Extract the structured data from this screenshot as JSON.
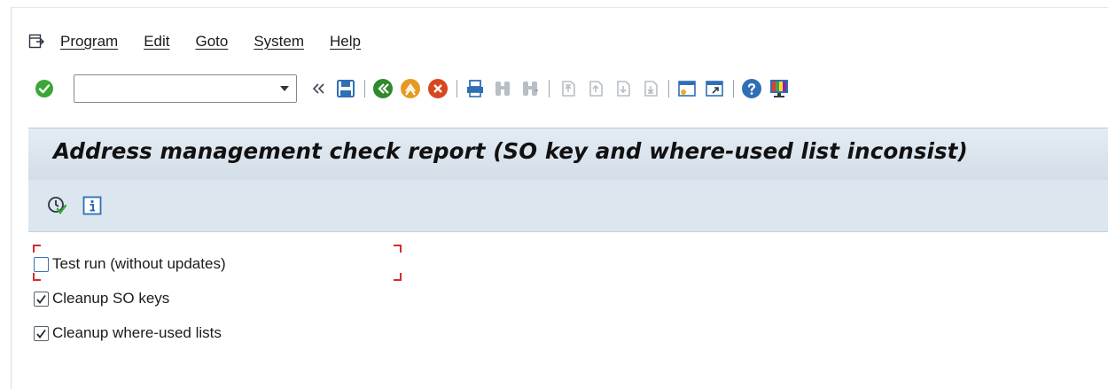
{
  "menu": {
    "items": [
      {
        "label": "Program"
      },
      {
        "label": "Edit"
      },
      {
        "label": "Goto"
      },
      {
        "label": "System"
      },
      {
        "label": "Help"
      }
    ]
  },
  "toolbar": {
    "command_value": "",
    "icons": [
      "enter-icon",
      "command-dropdown-icon",
      "collapse-icon",
      "save-icon",
      "back-icon",
      "exit-icon",
      "cancel-icon",
      "print-icon",
      "find-icon",
      "find-next-icon",
      "first-page-icon",
      "previous-page-icon",
      "next-page-icon",
      "last-page-icon",
      "create-session-icon",
      "shortcut-icon",
      "help-icon",
      "customize-layout-icon"
    ]
  },
  "report": {
    "title": "Address management check report (SO key and where-used list inconsist)",
    "actions": [
      "execute-icon",
      "information-icon"
    ]
  },
  "options": [
    {
      "label": "Test run (without updates)",
      "checked": false
    },
    {
      "label": "Cleanup SO keys",
      "checked": true
    },
    {
      "label": "Cleanup where-used lists",
      "checked": true
    }
  ],
  "colors": {
    "title_bar_bg": "#d9e3ec",
    "focus_frame": "#d62b2b",
    "enter_green": "#3aa636",
    "back_green": "#2f8a2c",
    "exit_orange": "#e69a22",
    "cancel_red": "#d8471f"
  }
}
